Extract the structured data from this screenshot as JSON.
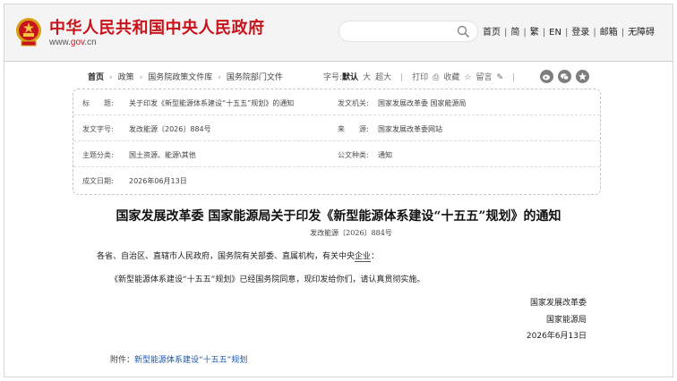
{
  "header": {
    "site_title": "中华人民共和国中央人民政府",
    "url_prefix": "www.",
    "url_gov": "gov",
    "url_suffix": ".cn",
    "nav": [
      "首页",
      "简",
      "繁",
      "EN",
      "登录",
      "邮箱",
      "无障碍"
    ],
    "brand_color": "#c9131b"
  },
  "breadcrumb": {
    "items": [
      "首页",
      "政策",
      "国务院政策文件库",
      "国务院部门文件"
    ]
  },
  "tools": {
    "font_label": "字号:",
    "font_default": "默认",
    "font_large": "大",
    "font_xlarge": "超大",
    "print": "打印",
    "favorite": "收藏",
    "comment": "留言"
  },
  "meta": {
    "title_label": "标　　题:",
    "title_value": "关于印发《新型能源体系建设“十五五”规划》的通知",
    "issuer_label": "发文机关:",
    "issuer_value": "国家发展改革委  国家能源局",
    "doc_no_label": "发文字号:",
    "doc_no_value": "发改能源〔2026〕884号",
    "source_label": "来　　源:",
    "source_value": "国家发展改革委网站",
    "topic_label": "主题分类:",
    "topic_value": "国土资源、能源\\其他",
    "type_label": "公文种类:",
    "type_value": "通知",
    "date_label": "成文日期:",
    "date_value": "2026年06月13日"
  },
  "article": {
    "title": "国家发展改革委  国家能源局关于印发《新型能源体系建设“十五五”规划》的通知",
    "number": "发改能源〔2026〕884号",
    "recipients_pre": "各省、自治区、直辖市人民政府，国务院有关部委、直属机构，有关中央",
    "recipients_ul": "企业",
    "recipients_post": "：",
    "body": "《新型能源体系建设“十五五”规划》已经国务院同意，现印发给你们，请认真贯彻实施。",
    "sign1": "国家发展改革委",
    "sign2": "国家能源局",
    "sign_date": "2026年6月13日",
    "attachment_label": "附件：",
    "attachment_link": "新型能源体系建设“十五五”规划"
  }
}
